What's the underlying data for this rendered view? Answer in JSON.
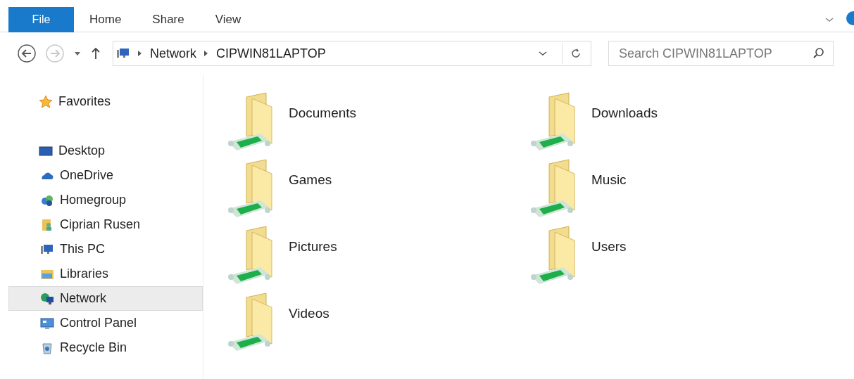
{
  "ribbon": {
    "tabs": [
      {
        "label": "File",
        "kind": "file"
      },
      {
        "label": "Home",
        "kind": "tab"
      },
      {
        "label": "Share",
        "kind": "tab"
      },
      {
        "label": "View",
        "kind": "tab"
      }
    ]
  },
  "address_bar": {
    "path": [
      "Network",
      "CIPWIN81LAPTOP"
    ],
    "back_disabled": false,
    "forward_disabled": true
  },
  "search": {
    "placeholder": "Search CIPWIN81LAPTOP"
  },
  "navigation_pane": {
    "items": [
      {
        "label": "Favorites",
        "kind": "star",
        "selected": false
      },
      {
        "label": "Desktop",
        "kind": "desktop",
        "selected": false,
        "children": [
          {
            "label": "OneDrive",
            "kind": "cloud",
            "selected": false
          },
          {
            "label": "Homegroup",
            "kind": "homegroup",
            "selected": false
          },
          {
            "label": "Ciprian Rusen",
            "kind": "user",
            "selected": false
          },
          {
            "label": "This PC",
            "kind": "pc",
            "selected": false
          },
          {
            "label": "Libraries",
            "kind": "libraries",
            "selected": false
          },
          {
            "label": "Network",
            "kind": "network",
            "selected": true
          },
          {
            "label": "Control Panel",
            "kind": "control",
            "selected": false
          },
          {
            "label": "Recycle Bin",
            "kind": "bin",
            "selected": false
          }
        ]
      }
    ]
  },
  "shared_folders": [
    {
      "name": "Documents"
    },
    {
      "name": "Downloads"
    },
    {
      "name": "Games"
    },
    {
      "name": "Music"
    },
    {
      "name": "Pictures"
    },
    {
      "name": "Users"
    },
    {
      "name": "Videos"
    }
  ]
}
